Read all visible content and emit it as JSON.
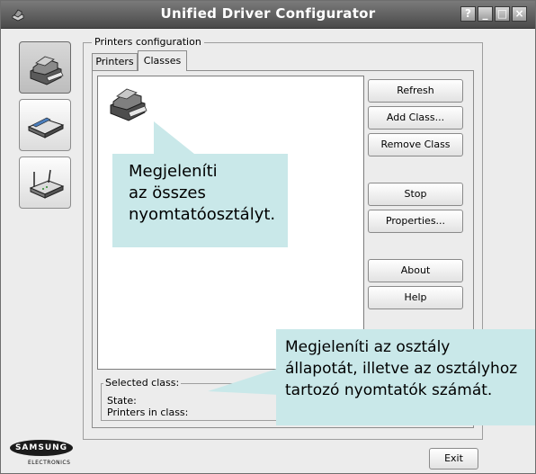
{
  "window": {
    "title": "Unified Driver Configurator",
    "controls": [
      "?",
      "_",
      "□",
      "×"
    ]
  },
  "sidebar": {
    "items": [
      {
        "name": "printers",
        "icon": "printer-icon",
        "active": true
      },
      {
        "name": "scanners",
        "icon": "scanner-icon",
        "active": false
      },
      {
        "name": "ports",
        "icon": "port-icon",
        "active": false
      }
    ]
  },
  "group": {
    "title": "Printers configuration"
  },
  "tabs": [
    {
      "label": "Printers",
      "active": false
    },
    {
      "label": "Classes",
      "active": true
    }
  ],
  "actions": {
    "refresh": "Refresh",
    "add_class": "Add Class...",
    "remove_class": "Remove Class",
    "stop": "Stop",
    "properties": "Properties...",
    "about": "About",
    "help": "Help"
  },
  "selected": {
    "title": "Selected class:",
    "state_label": "State:",
    "printers_label": "Printers in class:"
  },
  "callouts": {
    "list": [
      "Megjeleníti",
      "az összes",
      "nyomtatóosztályt."
    ],
    "status": [
      "Megjeleníti az osztály",
      "állapotát, illetve az osztályhoz",
      "tartozó nyomtatók számát."
    ]
  },
  "footer": {
    "exit": "Exit",
    "brand": "SAMSUNG",
    "brand_sub": "ELECTRONICS"
  },
  "colors": {
    "callout_bg": "#c9e8e9",
    "titlebar": "#5a5a5a"
  }
}
